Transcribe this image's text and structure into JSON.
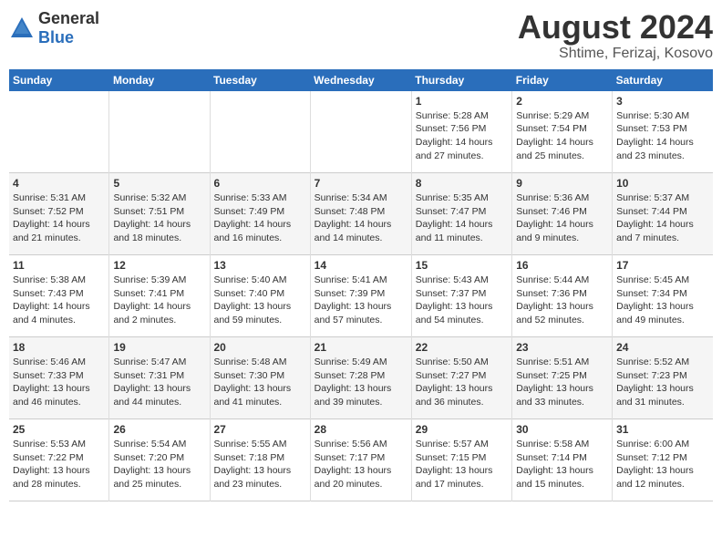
{
  "logo": {
    "general": "General",
    "blue": "Blue"
  },
  "title": "August 2024",
  "subtitle": "Shtime, Ferizaj, Kosovo",
  "headers": [
    "Sunday",
    "Monday",
    "Tuesday",
    "Wednesday",
    "Thursday",
    "Friday",
    "Saturday"
  ],
  "weeks": [
    [
      {
        "day": "",
        "info": ""
      },
      {
        "day": "",
        "info": ""
      },
      {
        "day": "",
        "info": ""
      },
      {
        "day": "",
        "info": ""
      },
      {
        "day": "1",
        "info": "Sunrise: 5:28 AM\nSunset: 7:56 PM\nDaylight: 14 hours\nand 27 minutes."
      },
      {
        "day": "2",
        "info": "Sunrise: 5:29 AM\nSunset: 7:54 PM\nDaylight: 14 hours\nand 25 minutes."
      },
      {
        "day": "3",
        "info": "Sunrise: 5:30 AM\nSunset: 7:53 PM\nDaylight: 14 hours\nand 23 minutes."
      }
    ],
    [
      {
        "day": "4",
        "info": "Sunrise: 5:31 AM\nSunset: 7:52 PM\nDaylight: 14 hours\nand 21 minutes."
      },
      {
        "day": "5",
        "info": "Sunrise: 5:32 AM\nSunset: 7:51 PM\nDaylight: 14 hours\nand 18 minutes."
      },
      {
        "day": "6",
        "info": "Sunrise: 5:33 AM\nSunset: 7:49 PM\nDaylight: 14 hours\nand 16 minutes."
      },
      {
        "day": "7",
        "info": "Sunrise: 5:34 AM\nSunset: 7:48 PM\nDaylight: 14 hours\nand 14 minutes."
      },
      {
        "day": "8",
        "info": "Sunrise: 5:35 AM\nSunset: 7:47 PM\nDaylight: 14 hours\nand 11 minutes."
      },
      {
        "day": "9",
        "info": "Sunrise: 5:36 AM\nSunset: 7:46 PM\nDaylight: 14 hours\nand 9 minutes."
      },
      {
        "day": "10",
        "info": "Sunrise: 5:37 AM\nSunset: 7:44 PM\nDaylight: 14 hours\nand 7 minutes."
      }
    ],
    [
      {
        "day": "11",
        "info": "Sunrise: 5:38 AM\nSunset: 7:43 PM\nDaylight: 14 hours\nand 4 minutes."
      },
      {
        "day": "12",
        "info": "Sunrise: 5:39 AM\nSunset: 7:41 PM\nDaylight: 14 hours\nand 2 minutes."
      },
      {
        "day": "13",
        "info": "Sunrise: 5:40 AM\nSunset: 7:40 PM\nDaylight: 13 hours\nand 59 minutes."
      },
      {
        "day": "14",
        "info": "Sunrise: 5:41 AM\nSunset: 7:39 PM\nDaylight: 13 hours\nand 57 minutes."
      },
      {
        "day": "15",
        "info": "Sunrise: 5:43 AM\nSunset: 7:37 PM\nDaylight: 13 hours\nand 54 minutes."
      },
      {
        "day": "16",
        "info": "Sunrise: 5:44 AM\nSunset: 7:36 PM\nDaylight: 13 hours\nand 52 minutes."
      },
      {
        "day": "17",
        "info": "Sunrise: 5:45 AM\nSunset: 7:34 PM\nDaylight: 13 hours\nand 49 minutes."
      }
    ],
    [
      {
        "day": "18",
        "info": "Sunrise: 5:46 AM\nSunset: 7:33 PM\nDaylight: 13 hours\nand 46 minutes."
      },
      {
        "day": "19",
        "info": "Sunrise: 5:47 AM\nSunset: 7:31 PM\nDaylight: 13 hours\nand 44 minutes."
      },
      {
        "day": "20",
        "info": "Sunrise: 5:48 AM\nSunset: 7:30 PM\nDaylight: 13 hours\nand 41 minutes."
      },
      {
        "day": "21",
        "info": "Sunrise: 5:49 AM\nSunset: 7:28 PM\nDaylight: 13 hours\nand 39 minutes."
      },
      {
        "day": "22",
        "info": "Sunrise: 5:50 AM\nSunset: 7:27 PM\nDaylight: 13 hours\nand 36 minutes."
      },
      {
        "day": "23",
        "info": "Sunrise: 5:51 AM\nSunset: 7:25 PM\nDaylight: 13 hours\nand 33 minutes."
      },
      {
        "day": "24",
        "info": "Sunrise: 5:52 AM\nSunset: 7:23 PM\nDaylight: 13 hours\nand 31 minutes."
      }
    ],
    [
      {
        "day": "25",
        "info": "Sunrise: 5:53 AM\nSunset: 7:22 PM\nDaylight: 13 hours\nand 28 minutes."
      },
      {
        "day": "26",
        "info": "Sunrise: 5:54 AM\nSunset: 7:20 PM\nDaylight: 13 hours\nand 25 minutes."
      },
      {
        "day": "27",
        "info": "Sunrise: 5:55 AM\nSunset: 7:18 PM\nDaylight: 13 hours\nand 23 minutes."
      },
      {
        "day": "28",
        "info": "Sunrise: 5:56 AM\nSunset: 7:17 PM\nDaylight: 13 hours\nand 20 minutes."
      },
      {
        "day": "29",
        "info": "Sunrise: 5:57 AM\nSunset: 7:15 PM\nDaylight: 13 hours\nand 17 minutes."
      },
      {
        "day": "30",
        "info": "Sunrise: 5:58 AM\nSunset: 7:14 PM\nDaylight: 13 hours\nand 15 minutes."
      },
      {
        "day": "31",
        "info": "Sunrise: 6:00 AM\nSunset: 7:12 PM\nDaylight: 13 hours\nand 12 minutes."
      }
    ]
  ]
}
